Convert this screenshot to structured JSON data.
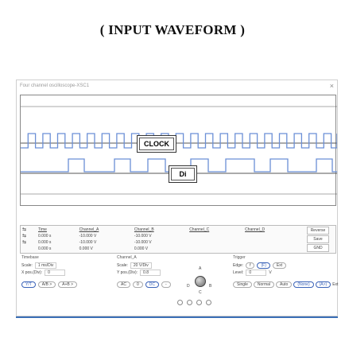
{
  "heading": "( INPUT WAVEFORM )",
  "window": {
    "title": "Four channel oscilloscope-XSC1",
    "close": "×"
  },
  "labels": {
    "top": "CLOCK",
    "bottom": "Di"
  },
  "readout": {
    "headers": [
      "Time",
      "Channel_A",
      "Channel_B",
      "Channel_C",
      "Channel_D"
    ],
    "rows": [
      [
        "0.000 s",
        "-10.000 V",
        "-10.000 V",
        "",
        ""
      ],
      [
        "0.000 s",
        "-10.000 V",
        "-10.000 V",
        "",
        ""
      ],
      [
        "0.000 s",
        "0.000 V",
        "0.000 V",
        "",
        ""
      ]
    ],
    "buttons": [
      "Reverse",
      "Save",
      "GND"
    ]
  },
  "timebase": {
    "header": "Timebase",
    "scale_label": "Scale:",
    "scale": "1 ms/Div",
    "xpos_label": "X pos.(Div):",
    "xpos": "0",
    "modes": [
      "Y/T",
      "A/B >",
      "A+B >"
    ]
  },
  "channel": {
    "header": "Channel_A",
    "scale_label": "Scale:",
    "scale": "20 V/Div",
    "ypos_label": "Y pos.(Div):",
    "ypos": "0.8",
    "coupling": [
      "AC",
      "0",
      "DC",
      "-"
    ]
  },
  "knob_labels": {
    "a": "A",
    "b": "B",
    "c": "C",
    "d": "D"
  },
  "trigger": {
    "header": "Trigger",
    "edge_label": "Edge:",
    "edge_options": [
      "f",
      "(F)",
      "Ext"
    ],
    "level_label": "Level:",
    "level": "0",
    "level_unit": "V",
    "modes": [
      "Single",
      "Normal",
      "Auto",
      "(None)",
      "(A>)",
      "Ext"
    ]
  },
  "colors": {
    "trace": "#6b8fd6",
    "grid": "#555555",
    "accent": "#3b6fb6"
  }
}
